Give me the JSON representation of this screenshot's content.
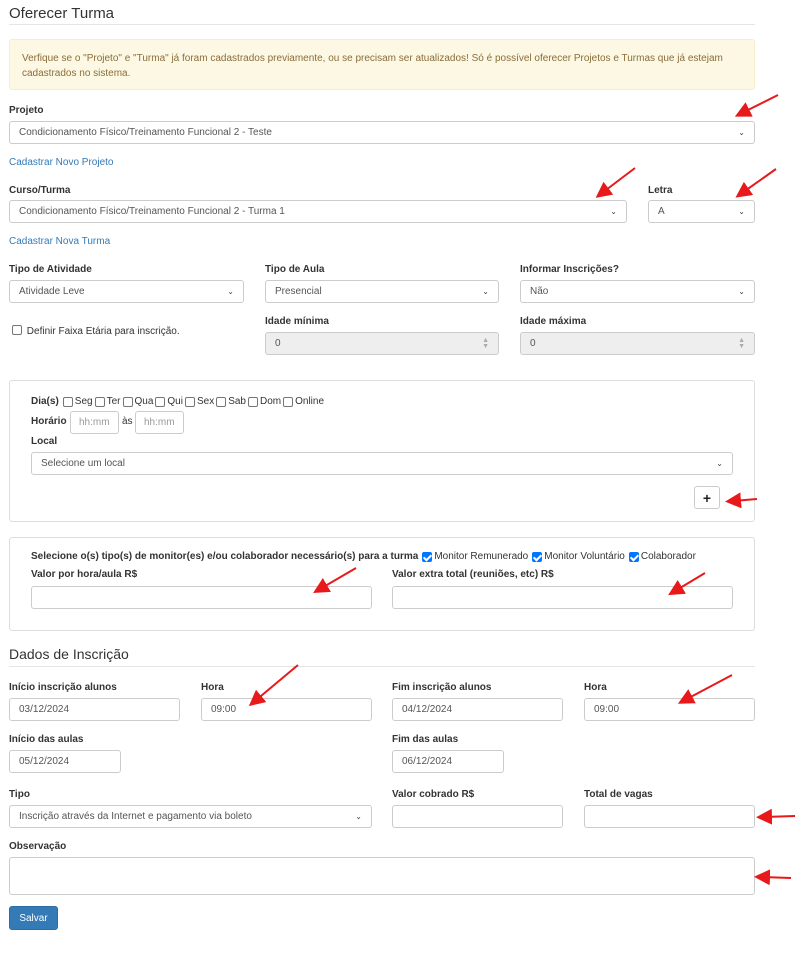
{
  "page": {
    "title": "Oferecer Turma",
    "alert": "Verfique se o \"Projeto\" e \"Turma\" já foram cadastrados previamente, ou se precisam ser atualizados! Só é possível oferecer Projetos e Turmas que já estejam cadastrados no sistema."
  },
  "projeto": {
    "label": "Projeto",
    "value": "Condicionamento Físico/Treinamento Funcional 2 - Teste",
    "link": "Cadastrar Novo Projeto"
  },
  "curso": {
    "label": "Curso/Turma",
    "value": "Condicionamento Físico/Treinamento Funcional 2 - Turma 1",
    "link": "Cadastrar Nova Turma",
    "letra_label": "Letra",
    "letra_value": "A"
  },
  "atividade": {
    "tipo_atividade_label": "Tipo de Atividade",
    "tipo_atividade_value": "Atividade Leve",
    "tipo_aula_label": "Tipo de Aula",
    "tipo_aula_value": "Presencial",
    "informar_label": "Informar Inscrições?",
    "informar_value": "Não",
    "faixa_label": "Definir Faixa Etária para inscrição.",
    "faixa_checked": false,
    "idade_min_label": "Idade mínima",
    "idade_min_value": "0",
    "idade_max_label": "Idade máxima",
    "idade_max_value": "0"
  },
  "horario": {
    "dias_label": "Dia(s)",
    "dias": [
      "Seg",
      "Ter",
      "Qua",
      "Qui",
      "Sex",
      "Sab",
      "Dom",
      "Online"
    ],
    "horario_label": "Horário",
    "ate_label": "às",
    "time_placeholder": "hh:mm",
    "local_label": "Local",
    "local_value": "Selecione um local",
    "add_symbol": "+"
  },
  "monitores": {
    "prompt": "Selecione o(s) tipo(s) de monitor(es) e/ou colaborador necessário(s) para a turma",
    "options": [
      {
        "label": "Monitor Remunerado",
        "checked": true
      },
      {
        "label": "Monitor Voluntário",
        "checked": true
      },
      {
        "label": "Colaborador",
        "checked": true
      }
    ],
    "valor_hora_label": "Valor por hora/aula R$",
    "valor_extra_label": "Valor extra total (reuniões, etc) R$"
  },
  "inscricao": {
    "section_title": "Dados de Inscrição",
    "inicio_label": "Início inscrição alunos",
    "inicio_value": "03/12/2024",
    "hora1_label": "Hora",
    "hora1_value": "09:00",
    "fim_label": "Fim inscrição alunos",
    "fim_value": "04/12/2024",
    "hora2_label": "Hora",
    "hora2_value": "09:00",
    "inicio_aulas_label": "Início das aulas",
    "inicio_aulas_value": "05/12/2024",
    "fim_aulas_label": "Fim das aulas",
    "fim_aulas_value": "06/12/2024",
    "tipo_label": "Tipo",
    "tipo_value": "Inscrição através da Internet e pagamento via boleto",
    "valor_label": "Valor cobrado R$",
    "vagas_label": "Total de vagas",
    "obs_label": "Observação",
    "save_label": "Salvar"
  },
  "colors": {
    "primary": "#337ab7",
    "alert_bg": "#fcf8e3",
    "alert_text": "#8a6d3b",
    "arrow": "#e8191a",
    "checkbox_on": "#0075ff"
  }
}
